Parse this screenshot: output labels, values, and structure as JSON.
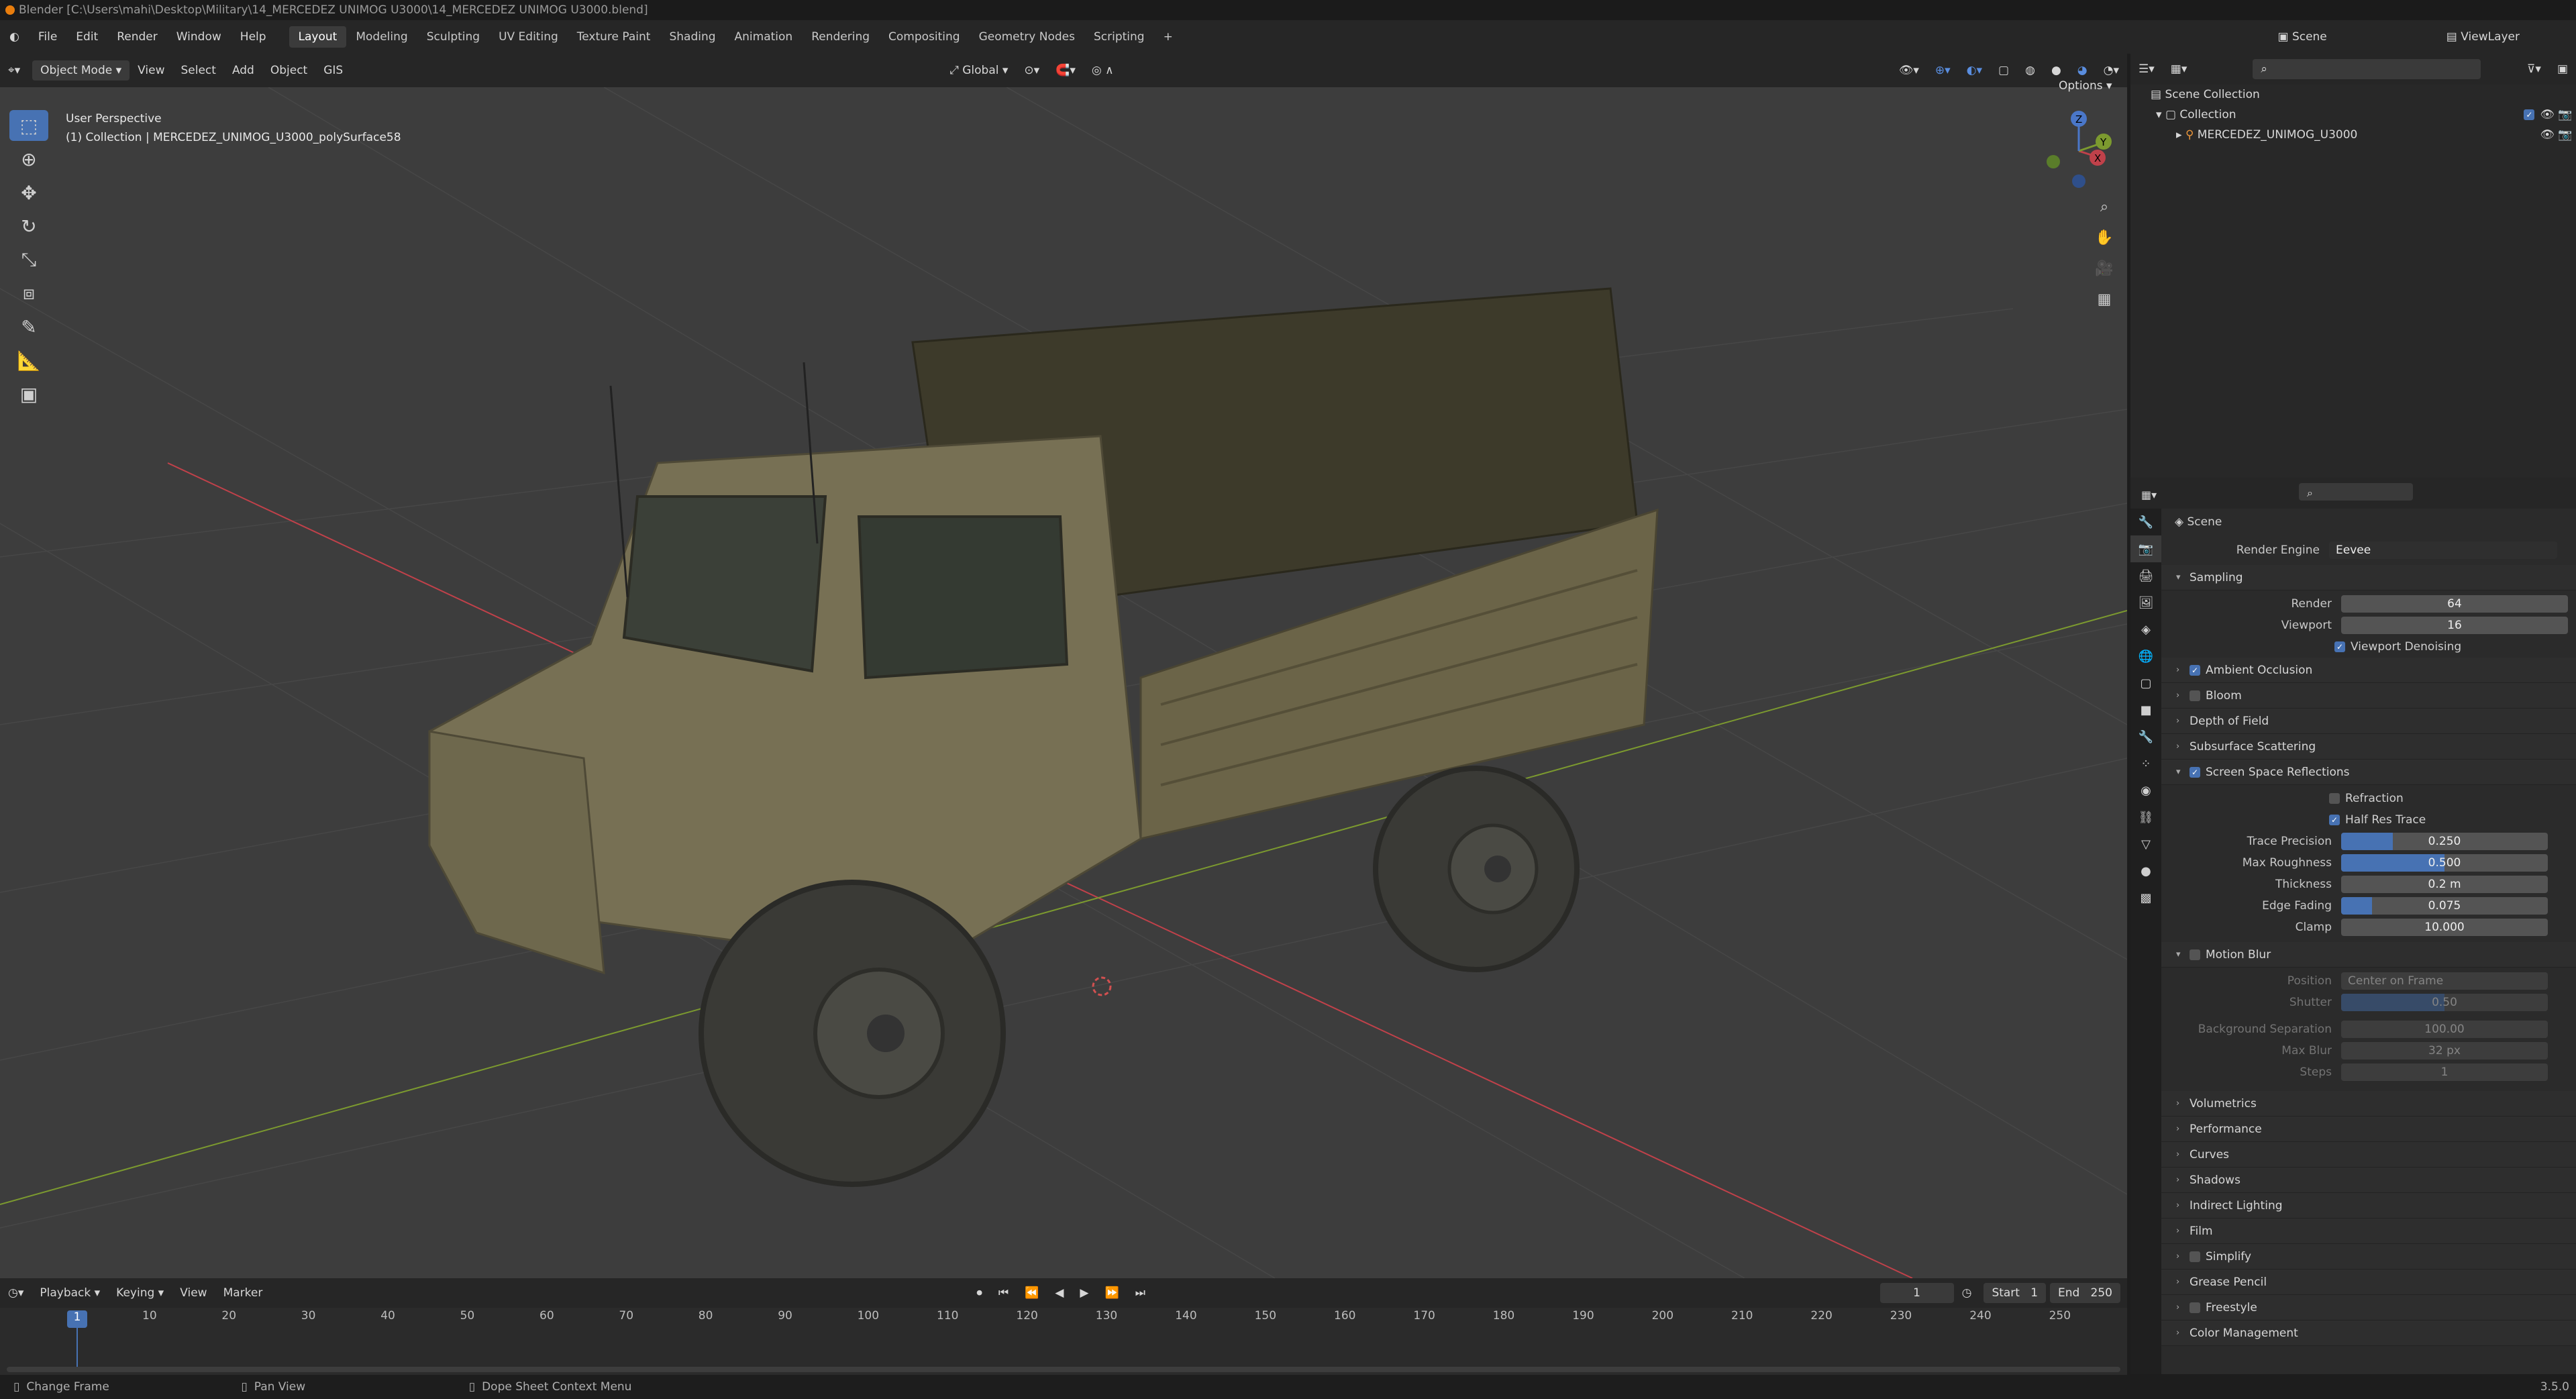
{
  "title": "Blender [C:\\Users\\mahi\\Desktop\\Military\\14_MERCEDEZ UNIMOG U3000\\14_MERCEDEZ UNIMOG U3000.blend]",
  "menu": [
    "File",
    "Edit",
    "Render",
    "Window",
    "Help"
  ],
  "workspaces": [
    "Layout",
    "Modeling",
    "Sculpting",
    "UV Editing",
    "Texture Paint",
    "Shading",
    "Animation",
    "Rendering",
    "Compositing",
    "Geometry Nodes",
    "Scripting"
  ],
  "active_workspace": "Layout",
  "scene_label": "Scene",
  "viewlayer_label": "ViewLayer",
  "vp_header": {
    "mode": "Object Mode",
    "view": "View",
    "select": "Select",
    "add": "Add",
    "object": "Object",
    "gis": "GIS",
    "orientation": "Global",
    "options": "Options"
  },
  "viewport": {
    "perspective": "User Perspective",
    "collection_line": "(1) Collection | MERCEDEZ_UNIMOG_U3000_polySurface58"
  },
  "gizmo": {
    "x": "X",
    "y": "Y",
    "z": "Z"
  },
  "timeline": {
    "playback": "Playback",
    "keying": "Keying",
    "view": "View",
    "marker": "Marker",
    "current_frame": "1",
    "start_label": "Start",
    "start": "1",
    "end_label": "End",
    "end": "250",
    "ticks": [
      "10",
      "20",
      "30",
      "40",
      "50",
      "60",
      "70",
      "80",
      "90",
      "100",
      "110",
      "120",
      "130",
      "140",
      "150",
      "160",
      "170",
      "180",
      "190",
      "200",
      "210",
      "220",
      "230",
      "240",
      "250"
    ]
  },
  "status": {
    "left": "Change Frame",
    "mid": "Pan View",
    "right": "Dope Sheet Context Menu",
    "version": "3.5.0"
  },
  "outliner": {
    "root": "Scene Collection",
    "collection": "Collection",
    "object": "MERCEDEZ_UNIMOG_U3000"
  },
  "props": {
    "scene": "Scene",
    "render_engine_label": "Render Engine",
    "render_engine": "Eevee",
    "sampling": "Sampling",
    "render_label": "Render",
    "render": "64",
    "viewport_label": "Viewport",
    "viewport": "16",
    "denoise": "Viewport Denoising",
    "ao": "Ambient Occlusion",
    "bloom": "Bloom",
    "dof": "Depth of Field",
    "sss": "Subsurface Scattering",
    "ssr": "Screen Space Reflections",
    "refraction": "Refraction",
    "half_res": "Half Res Trace",
    "trace_precision_label": "Trace Precision",
    "trace_precision": "0.250",
    "trace_precision_level": 0.25,
    "max_roughness_label": "Max Roughness",
    "max_roughness": "0.500",
    "max_roughness_level": 0.5,
    "thickness_label": "Thickness",
    "thickness": "0.2 m",
    "edge_fading_label": "Edge Fading",
    "edge_fading": "0.075",
    "edge_fading_level": 0.15,
    "clamp_label": "Clamp",
    "clamp": "10.000",
    "motion_blur": "Motion Blur",
    "position_label": "Position",
    "position": "Center on Frame",
    "shutter_label": "Shutter",
    "shutter": "0.50",
    "shutter_level": 0.5,
    "bg_sep_label": "Background Separation",
    "bg_sep": "100.00",
    "max_blur_label": "Max Blur",
    "max_blur": "32 px",
    "steps_label": "Steps",
    "steps": "1",
    "sections": [
      "Volumetrics",
      "Performance",
      "Curves",
      "Shadows",
      "Indirect Lighting",
      "Film",
      "Simplify",
      "Grease Pencil",
      "Freestyle",
      "Color Management"
    ]
  },
  "colors": {
    "accent": "#4772b3",
    "axis_x": "#c0414a",
    "axis_y": "#7c9a2f",
    "grid": "#474747"
  }
}
